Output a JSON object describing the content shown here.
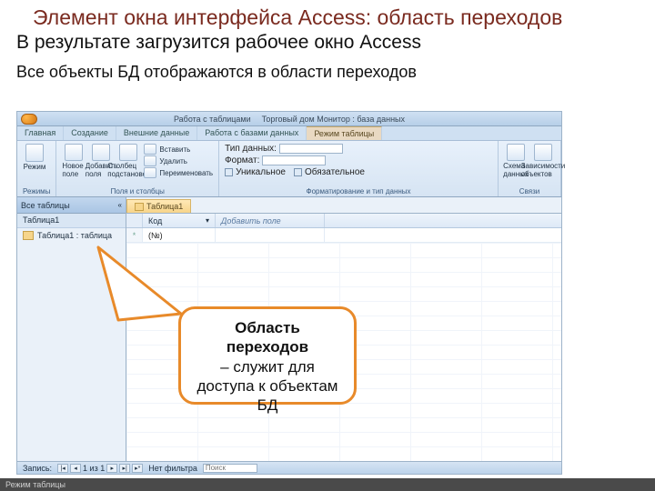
{
  "title": "Элемент окна интерфейса Access: область переходов",
  "subtitle": "В результате загрузится рабочее окно Access",
  "lead": "Все объекты БД отображаются в области переходов",
  "titlebar": {
    "context": "Работа с таблицами",
    "caption": "Торговый дом Монитор : база данных"
  },
  "ribbon_tabs": {
    "items": [
      "Главная",
      "Создание",
      "Внешние данные",
      "Работа с базами данных",
      "Режим таблицы"
    ],
    "active_index": 4
  },
  "ribbon": {
    "groups": [
      {
        "label": "Режимы",
        "big": [
          {
            "text": "Режим"
          }
        ]
      },
      {
        "label": "Поля и столбцы",
        "big": [
          {
            "text": "Новое поле"
          },
          {
            "text": "Добавить поля"
          },
          {
            "text": "Столбец подстановок"
          }
        ],
        "mini": [
          "Вставить",
          "Удалить",
          "Переименовать"
        ]
      },
      {
        "label": "Форматирование и тип данных",
        "rows": [
          {
            "k": "Тип данных:",
            "v": ""
          },
          {
            "k": "Формат:",
            "v": ""
          }
        ],
        "checks": [
          "Уникальное",
          "Обязательное"
        ]
      },
      {
        "label": "Связи",
        "big": [
          {
            "text": "Схема данных"
          },
          {
            "text": "Зависимости объектов"
          }
        ]
      }
    ]
  },
  "nav": {
    "header": "Все таблицы",
    "section": "Таблица1",
    "item": "Таблица1 : таблица"
  },
  "doc_tab": "Таблица1",
  "grid": {
    "headers": {
      "sel": "",
      "c1": "Код",
      "c2": "Добавить поле"
    },
    "row1": {
      "marker": "*",
      "c1": "(№)",
      "c2": ""
    }
  },
  "status": {
    "label": "Запись:",
    "pos": "1 из 1",
    "filter": "Нет фильтра",
    "search": "Поиск"
  },
  "callout": {
    "heading": "Область переходов",
    "body": "– служит для доступа к объектам БД"
  },
  "bottom": "Режим таблицы"
}
